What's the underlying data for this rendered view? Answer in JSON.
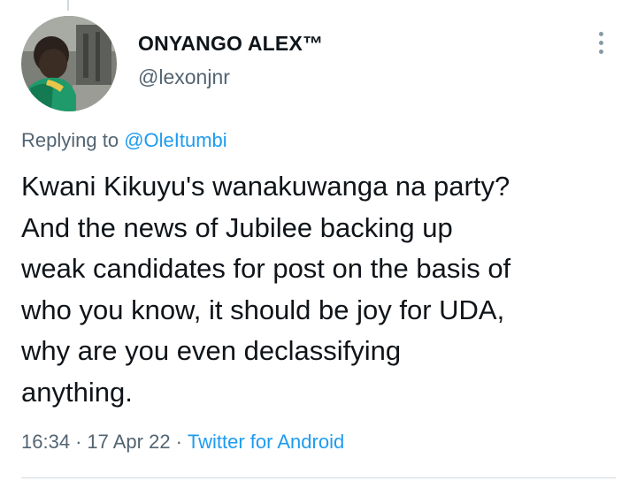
{
  "tweet": {
    "author": {
      "display_name": "ONYANGO ALEX™",
      "handle": "@lexonjnr",
      "avatar_icon": "user-avatar-photo"
    },
    "reply_context": {
      "prefix": "Replying to",
      "mention": "@OleItumbi"
    },
    "text_lines": [
      "Kwani Kikuyu's wanakuwanga na party?",
      "And the news of Jubilee backing up",
      "weak candidates for post on the basis of",
      "who you know, it should be joy for UDA,",
      "why are you even declassifying",
      "anything."
    ],
    "meta": {
      "time": "16:34",
      "separator": "·",
      "date": "17 Apr 22",
      "source": "Twitter for Android"
    },
    "menu_icon": "more-vertical-icon"
  },
  "colors": {
    "text_primary": "#0f1419",
    "text_secondary": "#536471",
    "link": "#1d9bf0",
    "divider": "#cfd9de"
  }
}
